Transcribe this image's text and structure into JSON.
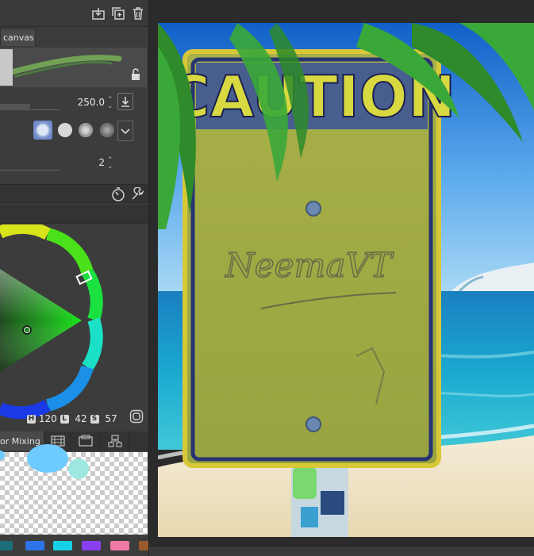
{
  "colors": {
    "panel_bg": "#3c3c3c",
    "accent_selected": "#6e88c8",
    "current_color": "#1db61d"
  },
  "tool_property": {
    "tab_label": "canvas",
    "brush_size": {
      "value": "250.0"
    },
    "brush_density": {
      "value": "2"
    },
    "icons": [
      "export-icon",
      "duplicate-icon",
      "trash-icon",
      "lock-icon",
      "download-icon",
      "chevron-down-icon",
      "timer-icon",
      "wrench-icon"
    ]
  },
  "color_wheel": {
    "h_label": "H",
    "h_value": "120",
    "l_label": "L",
    "l_value": "42",
    "s_label": "S",
    "s_value": "57"
  },
  "bottom_tabs": {
    "color_mixing_label": "or Mixing"
  },
  "palette": {
    "swatches": [
      "#1b6e7a",
      "#2e74e8",
      "#19d1e6",
      "#8a3ff0",
      "#f07aa6",
      "#9a5a2a"
    ]
  },
  "artwork": {
    "sign_title": "CAUTION",
    "signature_text": "NeemaVT"
  }
}
